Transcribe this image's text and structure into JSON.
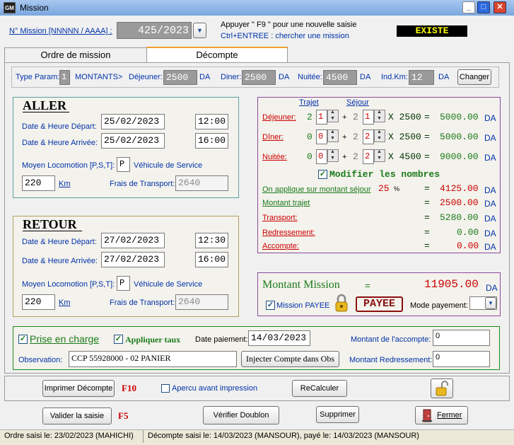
{
  "window": {
    "title": "Mission",
    "icon_text": "GM"
  },
  "header": {
    "mission_label": "N° Mission  [NNNNN / AAAA] :",
    "mission_value": "425/2023",
    "hint1": "Appuyer \" F9 \" pour une nouvelle saisie",
    "hint2": "Ctrl+ENTREE : chercher une mission",
    "status": "EXISTE"
  },
  "tabs": [
    {
      "label": "Ordre de mission"
    },
    {
      "label": "Décompte"
    }
  ],
  "params": {
    "type_label": "Type Param:",
    "type_value": "1",
    "montants_label": "MONTANTS>",
    "dej_label": "Déjeuner:",
    "dej_value": "2500",
    "diner_label": "Diner:",
    "diner_value": "2500",
    "nuitee_label": "Nuitée:",
    "nuitee_value": "4500",
    "indkm_label": "Ind.Km:",
    "indkm_value": "12",
    "da": "DA",
    "changer": "Changer"
  },
  "aller": {
    "title": "ALLER",
    "dep_label": "Date & Heure Départ:",
    "dep_date": "25/02/2023",
    "dep_time": "12:00",
    "arr_label": "Date & Heure Arrivée:",
    "arr_date": "25/02/2023",
    "arr_time": "16:00",
    "moyen_label": "Moyen Locomotion [P,S,T]:",
    "moyen_value": "P",
    "moyen_desc": "Véhicule de Service",
    "km_value": "220",
    "km_label": "Km",
    "frais_label": "Frais de Transport:",
    "frais_value": "2640"
  },
  "retour": {
    "title": "RETOUR",
    "dep_label": "Date & Heure Départ:",
    "dep_date": "27/02/2023",
    "dep_time": "12:30",
    "arr_label": "Date & Heure Arrivée:",
    "arr_date": "27/02/2023",
    "arr_time": "16:00",
    "moyen_label": "Moyen Locomotion [P,S,T]:",
    "moyen_value": "P",
    "moyen_desc": "Véhicule de Service",
    "km_value": "220",
    "km_label": "Km",
    "frais_label": "Frais de Transport:",
    "frais_value": "2640"
  },
  "calc": {
    "trajet_label": "Trajet",
    "sejour_label": "Séjour",
    "rows": [
      {
        "label": "Déjeuner:",
        "a": "2",
        "trajet": "1",
        "b": "2",
        "sejour": "1",
        "rate": "X 2500",
        "eq": "=",
        "total": "5000.00",
        "da": "DA"
      },
      {
        "label": "Dîner:",
        "a": "0",
        "trajet": "0",
        "b": "2",
        "sejour": "2",
        "rate": "X 2500",
        "eq": "=",
        "total": "5000.00",
        "da": "DA"
      },
      {
        "label": "Nuitée:",
        "a": "0",
        "trajet": "0",
        "b": "2",
        "sejour": "2",
        "rate": "X 4500",
        "eq": "=",
        "total": "9000.00",
        "da": "DA"
      }
    ],
    "plus": "+",
    "modifier": "Modifier les nombres",
    "applique_label": "On applique sur montant séjour",
    "applique_pct": "25",
    "pct": "%",
    "applique_value": "4125.00",
    "trajet_sum_label": "Montant trajet",
    "trajet_sum": "2500.00",
    "transport_label": "Transport:",
    "transport": "5280.00",
    "redress_label": "Redressement:",
    "redress": "0.00",
    "acompte_label": "Accompte:",
    "acompte": "0.00",
    "eq": "=",
    "da": "DA"
  },
  "montant": {
    "label": "Montant Mission",
    "eq": "=",
    "value": "11905.00",
    "da": "DA",
    "payee_chk": "Mission PAYEE",
    "payee_stamp": "PAYEE",
    "mode_label": "Mode payement:"
  },
  "prise": {
    "label": "Prise en charge",
    "appliquer": "Appliquer taux",
    "date_label": "Date paiement:",
    "date_value": "14/03/2023",
    "acompte_label": "Montant de l'accompte:",
    "acompte_value": "0",
    "obs_label": "Observation:",
    "obs_value": "CCP 55928000     - 02 PANIER",
    "injecter": "Injecter Compte dans Obs",
    "redress_label": "Montant Redressement:",
    "redress_value": "0"
  },
  "actions": {
    "imprimer": "Imprimer Décompte",
    "f10": "F10",
    "apercu": "Apercu avant impression",
    "recalculer": "ReCalculer",
    "valider": "Valider la saisie",
    "f5": "F5",
    "verifier": "Vérifier Doublon",
    "supprimer": "Supprimer",
    "fermer": "Fermer"
  },
  "statusbar": {
    "left": "Ordre saisi le: 23/02/2023 (MAHICHI)",
    "right": "Décompte saisi le: 14/03/2023 (MANSOUR), payé le: 14/03/2023 (MANSOUR)"
  },
  "colors": {
    "accent": "#0033aa",
    "green": "#1a7a1a",
    "red": "#cc0000",
    "status_bg": "#000000",
    "status_fg": "#ffff00"
  }
}
